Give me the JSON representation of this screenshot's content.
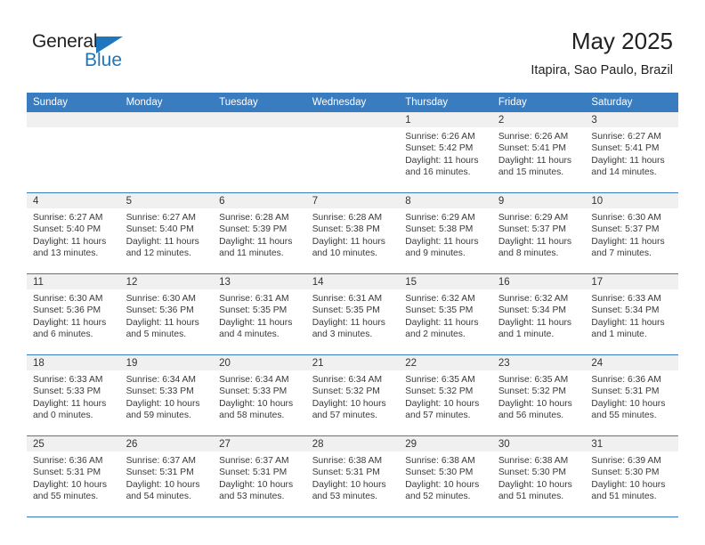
{
  "brand": {
    "name_part1": "General",
    "name_part2": "Blue",
    "accent_color": "#1f76bc"
  },
  "header": {
    "title": "May 2025",
    "subtitle": "Itapira, Sao Paulo, Brazil"
  },
  "calendar": {
    "header_bg": "#3a7cc0",
    "weekdays": [
      "Sunday",
      "Monday",
      "Tuesday",
      "Wednesday",
      "Thursday",
      "Friday",
      "Saturday"
    ],
    "weeks": [
      [
        {
          "day": "",
          "empty": true
        },
        {
          "day": "",
          "empty": true
        },
        {
          "day": "",
          "empty": true
        },
        {
          "day": "",
          "empty": true
        },
        {
          "day": "1",
          "sunrise": "Sunrise: 6:26 AM",
          "sunset": "Sunset: 5:42 PM",
          "daylight1": "Daylight: 11 hours",
          "daylight2": "and 16 minutes."
        },
        {
          "day": "2",
          "sunrise": "Sunrise: 6:26 AM",
          "sunset": "Sunset: 5:41 PM",
          "daylight1": "Daylight: 11 hours",
          "daylight2": "and 15 minutes."
        },
        {
          "day": "3",
          "sunrise": "Sunrise: 6:27 AM",
          "sunset": "Sunset: 5:41 PM",
          "daylight1": "Daylight: 11 hours",
          "daylight2": "and 14 minutes."
        }
      ],
      [
        {
          "day": "4",
          "sunrise": "Sunrise: 6:27 AM",
          "sunset": "Sunset: 5:40 PM",
          "daylight1": "Daylight: 11 hours",
          "daylight2": "and 13 minutes."
        },
        {
          "day": "5",
          "sunrise": "Sunrise: 6:27 AM",
          "sunset": "Sunset: 5:40 PM",
          "daylight1": "Daylight: 11 hours",
          "daylight2": "and 12 minutes."
        },
        {
          "day": "6",
          "sunrise": "Sunrise: 6:28 AM",
          "sunset": "Sunset: 5:39 PM",
          "daylight1": "Daylight: 11 hours",
          "daylight2": "and 11 minutes."
        },
        {
          "day": "7",
          "sunrise": "Sunrise: 6:28 AM",
          "sunset": "Sunset: 5:38 PM",
          "daylight1": "Daylight: 11 hours",
          "daylight2": "and 10 minutes."
        },
        {
          "day": "8",
          "sunrise": "Sunrise: 6:29 AM",
          "sunset": "Sunset: 5:38 PM",
          "daylight1": "Daylight: 11 hours",
          "daylight2": "and 9 minutes."
        },
        {
          "day": "9",
          "sunrise": "Sunrise: 6:29 AM",
          "sunset": "Sunset: 5:37 PM",
          "daylight1": "Daylight: 11 hours",
          "daylight2": "and 8 minutes."
        },
        {
          "day": "10",
          "sunrise": "Sunrise: 6:30 AM",
          "sunset": "Sunset: 5:37 PM",
          "daylight1": "Daylight: 11 hours",
          "daylight2": "and 7 minutes."
        }
      ],
      [
        {
          "day": "11",
          "sunrise": "Sunrise: 6:30 AM",
          "sunset": "Sunset: 5:36 PM",
          "daylight1": "Daylight: 11 hours",
          "daylight2": "and 6 minutes."
        },
        {
          "day": "12",
          "sunrise": "Sunrise: 6:30 AM",
          "sunset": "Sunset: 5:36 PM",
          "daylight1": "Daylight: 11 hours",
          "daylight2": "and 5 minutes."
        },
        {
          "day": "13",
          "sunrise": "Sunrise: 6:31 AM",
          "sunset": "Sunset: 5:35 PM",
          "daylight1": "Daylight: 11 hours",
          "daylight2": "and 4 minutes."
        },
        {
          "day": "14",
          "sunrise": "Sunrise: 6:31 AM",
          "sunset": "Sunset: 5:35 PM",
          "daylight1": "Daylight: 11 hours",
          "daylight2": "and 3 minutes."
        },
        {
          "day": "15",
          "sunrise": "Sunrise: 6:32 AM",
          "sunset": "Sunset: 5:35 PM",
          "daylight1": "Daylight: 11 hours",
          "daylight2": "and 2 minutes."
        },
        {
          "day": "16",
          "sunrise": "Sunrise: 6:32 AM",
          "sunset": "Sunset: 5:34 PM",
          "daylight1": "Daylight: 11 hours",
          "daylight2": "and 1 minute."
        },
        {
          "day": "17",
          "sunrise": "Sunrise: 6:33 AM",
          "sunset": "Sunset: 5:34 PM",
          "daylight1": "Daylight: 11 hours",
          "daylight2": "and 1 minute."
        }
      ],
      [
        {
          "day": "18",
          "sunrise": "Sunrise: 6:33 AM",
          "sunset": "Sunset: 5:33 PM",
          "daylight1": "Daylight: 11 hours",
          "daylight2": "and 0 minutes."
        },
        {
          "day": "19",
          "sunrise": "Sunrise: 6:34 AM",
          "sunset": "Sunset: 5:33 PM",
          "daylight1": "Daylight: 10 hours",
          "daylight2": "and 59 minutes."
        },
        {
          "day": "20",
          "sunrise": "Sunrise: 6:34 AM",
          "sunset": "Sunset: 5:33 PM",
          "daylight1": "Daylight: 10 hours",
          "daylight2": "and 58 minutes."
        },
        {
          "day": "21",
          "sunrise": "Sunrise: 6:34 AM",
          "sunset": "Sunset: 5:32 PM",
          "daylight1": "Daylight: 10 hours",
          "daylight2": "and 57 minutes."
        },
        {
          "day": "22",
          "sunrise": "Sunrise: 6:35 AM",
          "sunset": "Sunset: 5:32 PM",
          "daylight1": "Daylight: 10 hours",
          "daylight2": "and 57 minutes."
        },
        {
          "day": "23",
          "sunrise": "Sunrise: 6:35 AM",
          "sunset": "Sunset: 5:32 PM",
          "daylight1": "Daylight: 10 hours",
          "daylight2": "and 56 minutes."
        },
        {
          "day": "24",
          "sunrise": "Sunrise: 6:36 AM",
          "sunset": "Sunset: 5:31 PM",
          "daylight1": "Daylight: 10 hours",
          "daylight2": "and 55 minutes."
        }
      ],
      [
        {
          "day": "25",
          "sunrise": "Sunrise: 6:36 AM",
          "sunset": "Sunset: 5:31 PM",
          "daylight1": "Daylight: 10 hours",
          "daylight2": "and 55 minutes."
        },
        {
          "day": "26",
          "sunrise": "Sunrise: 6:37 AM",
          "sunset": "Sunset: 5:31 PM",
          "daylight1": "Daylight: 10 hours",
          "daylight2": "and 54 minutes."
        },
        {
          "day": "27",
          "sunrise": "Sunrise: 6:37 AM",
          "sunset": "Sunset: 5:31 PM",
          "daylight1": "Daylight: 10 hours",
          "daylight2": "and 53 minutes."
        },
        {
          "day": "28",
          "sunrise": "Sunrise: 6:38 AM",
          "sunset": "Sunset: 5:31 PM",
          "daylight1": "Daylight: 10 hours",
          "daylight2": "and 53 minutes."
        },
        {
          "day": "29",
          "sunrise": "Sunrise: 6:38 AM",
          "sunset": "Sunset: 5:30 PM",
          "daylight1": "Daylight: 10 hours",
          "daylight2": "and 52 minutes."
        },
        {
          "day": "30",
          "sunrise": "Sunrise: 6:38 AM",
          "sunset": "Sunset: 5:30 PM",
          "daylight1": "Daylight: 10 hours",
          "daylight2": "and 51 minutes."
        },
        {
          "day": "31",
          "sunrise": "Sunrise: 6:39 AM",
          "sunset": "Sunset: 5:30 PM",
          "daylight1": "Daylight: 10 hours",
          "daylight2": "and 51 minutes."
        }
      ]
    ]
  }
}
